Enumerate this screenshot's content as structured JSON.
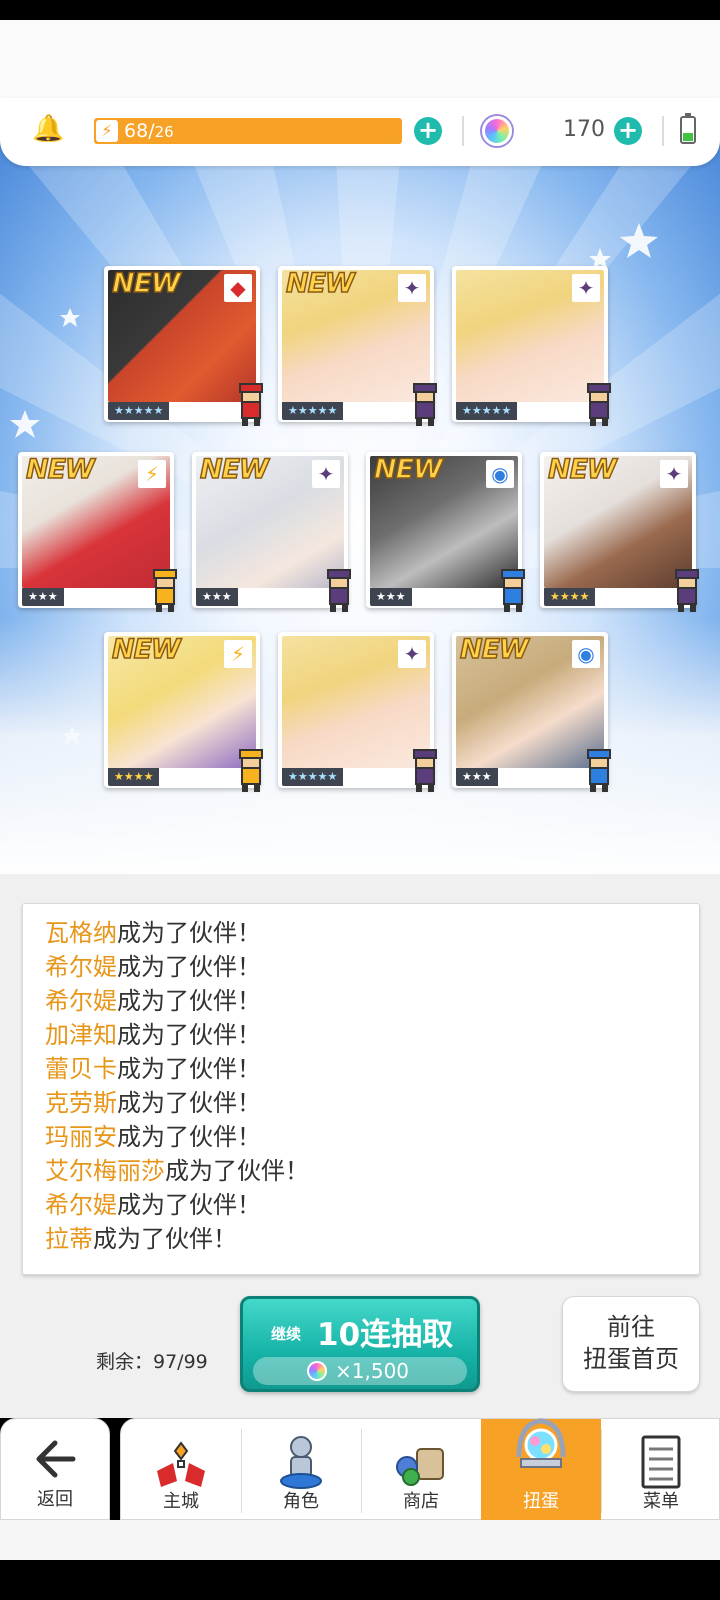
{
  "header": {
    "stamina_current": "68",
    "stamina_max": "26",
    "gem_count": "170",
    "battery_level": 0.35
  },
  "cards": [
    {
      "id": 1,
      "new_label": "NEW",
      "element": "diamond-cluster",
      "stars": "★★★★★",
      "rarity": 5
    },
    {
      "id": 2,
      "new_label": "NEW",
      "element": "dark-star",
      "stars": "★★★★★",
      "rarity": 5
    },
    {
      "id": 3,
      "new_label": "",
      "element": "dark-star",
      "stars": "★★★★★",
      "rarity": 5
    },
    {
      "id": 4,
      "new_label": "NEW",
      "element": "lightning",
      "stars": "★★★",
      "rarity": 3
    },
    {
      "id": 5,
      "new_label": "NEW",
      "element": "dark-star",
      "stars": "★★★",
      "rarity": 3
    },
    {
      "id": 6,
      "new_label": "NEW",
      "element": "water-circle",
      "stars": "★★★",
      "rarity": 3
    },
    {
      "id": 7,
      "new_label": "NEW",
      "element": "dark-star",
      "stars": "★★★★",
      "rarity": 4
    },
    {
      "id": 8,
      "new_label": "NEW",
      "element": "lightning",
      "stars": "★★★★",
      "rarity": 4
    },
    {
      "id": 9,
      "new_label": "",
      "element": "dark-star",
      "stars": "★★★★★",
      "rarity": 5
    },
    {
      "id": 10,
      "new_label": "NEW",
      "element": "water-circle",
      "stars": "★★★",
      "rarity": 3
    }
  ],
  "log": {
    "suffix": "成为了伙伴！",
    "names": [
      "瓦格纳",
      "希尔媞",
      "希尔媞",
      "加津知",
      "蕾贝卡",
      "克劳斯",
      "玛丽安",
      "艾尔梅丽莎",
      "希尔媞",
      "拉蒂"
    ]
  },
  "actions": {
    "remaining": "剩余：97/99",
    "continue_label": "继续",
    "pull_label": "10连抽取",
    "cost": "×1,500",
    "gacha_home_line1": "前往",
    "gacha_home_line2": "扭蛋首页"
  },
  "nav": {
    "back": "返回",
    "tabs": [
      "主城",
      "角色",
      "商店",
      "扭蛋",
      "菜单"
    ],
    "active": "扭蛋"
  },
  "colors": {
    "accent_orange": "#f7a126",
    "teal": "#1fbcae",
    "name_orange": "#e7961a"
  }
}
